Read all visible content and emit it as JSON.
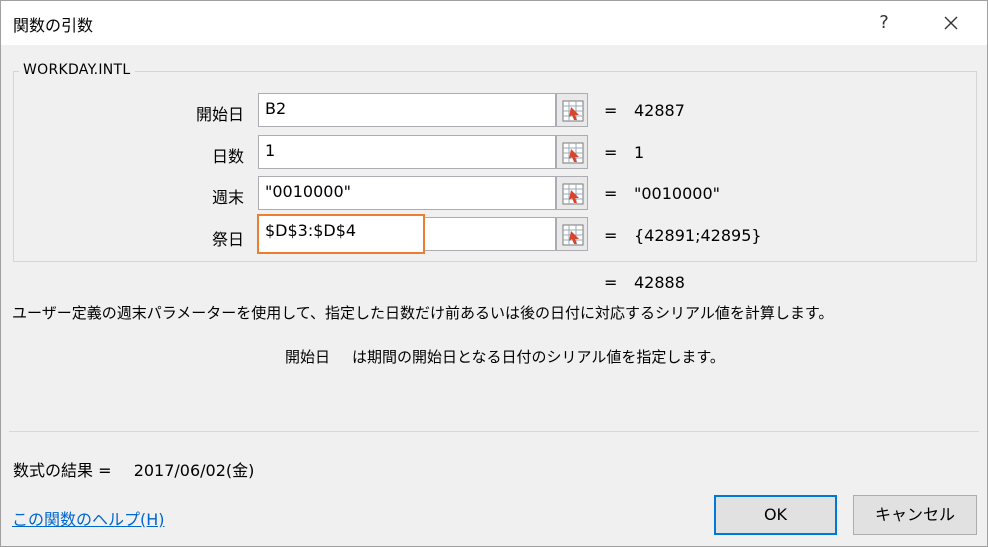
{
  "window": {
    "title": "関数の引数",
    "help_glyph": "?",
    "close_glyph": "✕"
  },
  "function": {
    "name": "WORKDAY.INTL",
    "args": [
      {
        "label": "開始日",
        "value": "B2",
        "result": "42887"
      },
      {
        "label": "日数",
        "value": "1",
        "result": "1"
      },
      {
        "label": "週末",
        "value": "\"0010000\"",
        "result": "\"0010000\""
      },
      {
        "label": "祭日",
        "value": "$D$3:$D$4",
        "result": "{42891;42895}"
      }
    ],
    "equals": "=",
    "total_result": "42888"
  },
  "description": {
    "function_text": "ユーザー定義の週末パラメーターを使用して、指定した日数だけ前あるいは後の日付に対応するシリアル値を計算します。",
    "arg_name": "開始日",
    "arg_text": "は期間の開始日となる日付のシリアル値を指定します。"
  },
  "formula_result": {
    "label": "数式の結果 =",
    "value": "2017/06/02(金)"
  },
  "footer": {
    "help_link": "この関数のヘルプ(H)",
    "ok_label": "OK",
    "cancel_label": "キャンセル"
  },
  "colors": {
    "highlight_border": "#ed7d31",
    "link": "#0066cc",
    "ok_border": "#0078d7"
  }
}
